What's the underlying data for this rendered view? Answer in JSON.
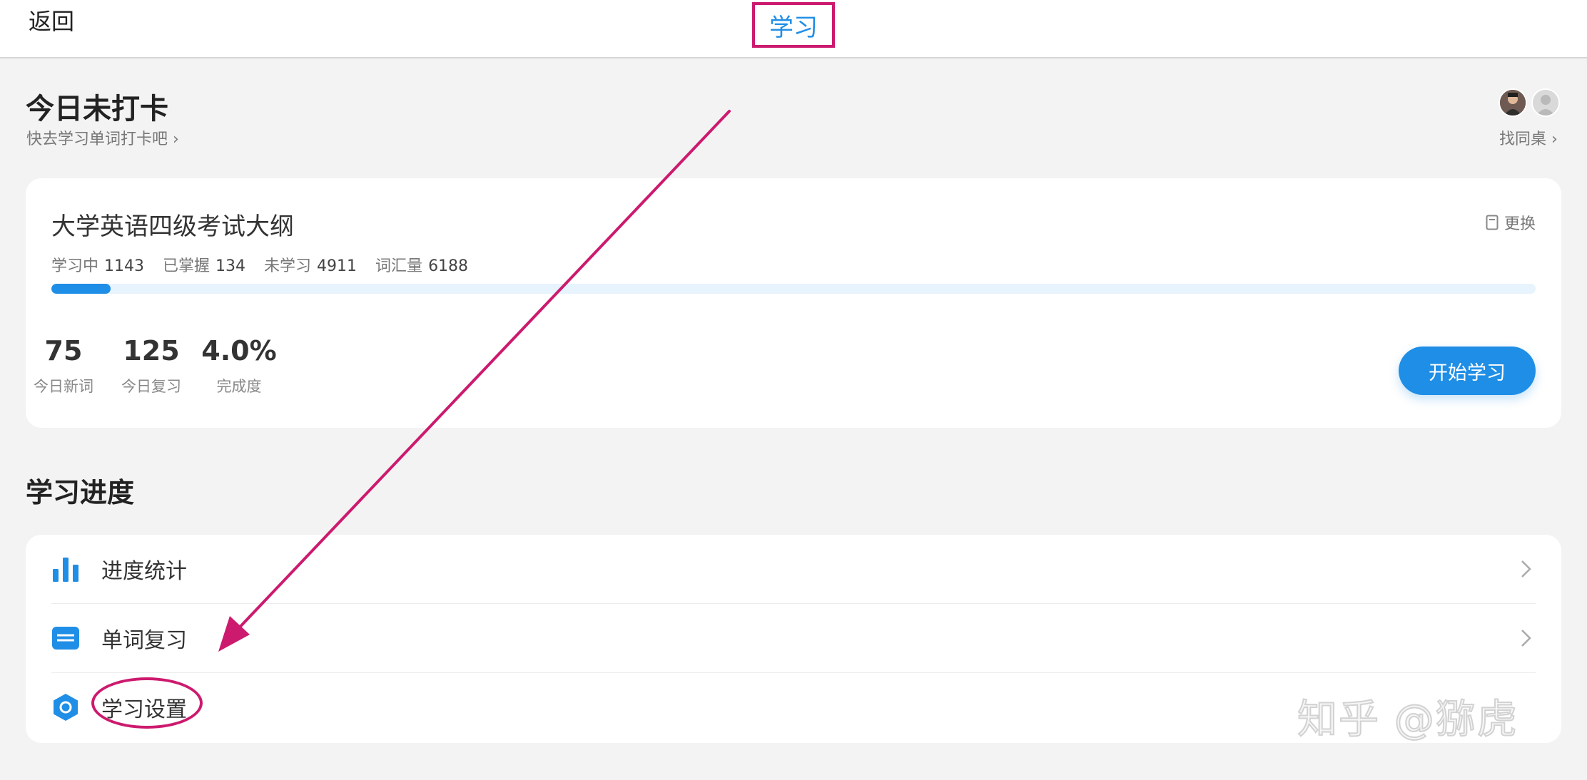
{
  "nav": {
    "back_label": "返回",
    "title": "学习"
  },
  "checkin": {
    "title": "今日未打卡",
    "subtitle": "快去学习单词打卡吧",
    "deskmate_label": "找同桌"
  },
  "book": {
    "title": "大学英语四级考试大纲",
    "change_label": "更换",
    "stats": [
      {
        "label": "学习中",
        "value": "1143"
      },
      {
        "label": "已掌握",
        "value": "134"
      },
      {
        "label": "未学习",
        "value": "4911"
      },
      {
        "label": "词汇量",
        "value": "6188"
      }
    ],
    "progress_fraction": 0.04,
    "metrics": [
      {
        "value": "75",
        "label": "今日新词"
      },
      {
        "value": "125",
        "label": "今日复习"
      },
      {
        "value": "4.0%",
        "label": "完成度"
      }
    ],
    "start_label": "开始学习"
  },
  "progress_section": {
    "title": "学习进度",
    "items": [
      {
        "label": "进度统计",
        "icon": "bar-chart-icon"
      },
      {
        "label": "单词复习",
        "icon": "card-stack-icon"
      },
      {
        "label": "学习设置",
        "icon": "hexagon-settings-icon"
      }
    ]
  },
  "watermark": "知乎 @猕虎",
  "colors": {
    "accent": "#1f8ee6",
    "annotation": "#cc1a6e",
    "background": "#f3f3f3"
  }
}
